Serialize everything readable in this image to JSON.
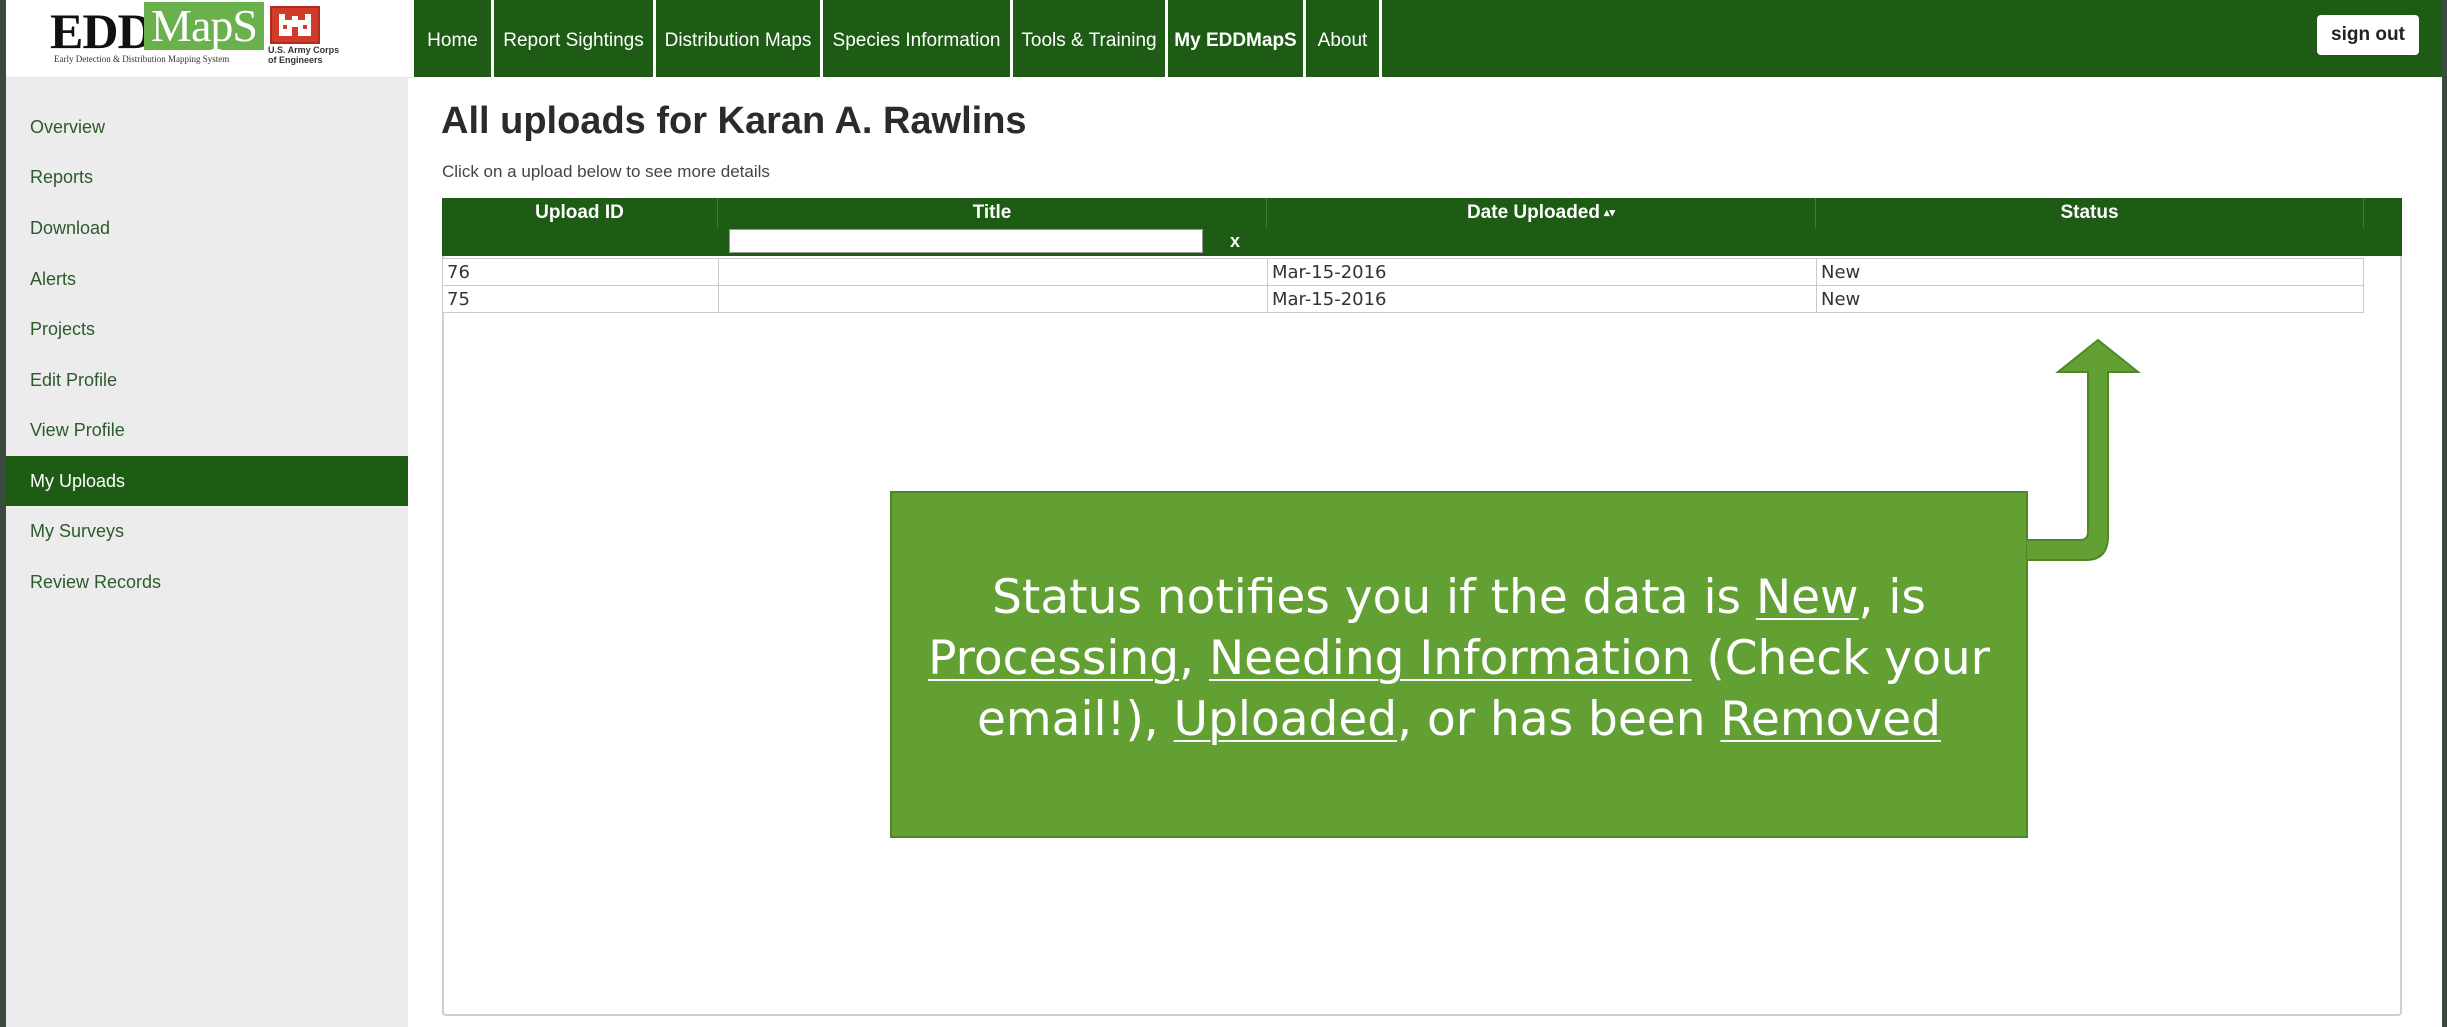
{
  "brand": {
    "logo_edd": "EDD",
    "logo_maps": "MapS",
    "tagline": "Early Detection & Distribution Mapping System",
    "partner_line1": "U.S. Army Corps",
    "partner_line2": "of Engineers"
  },
  "nav": {
    "items": [
      {
        "label": "Home"
      },
      {
        "label": "Report Sightings"
      },
      {
        "label": "Distribution Maps"
      },
      {
        "label": "Species Information"
      },
      {
        "label": "Tools & Training"
      },
      {
        "label": "My EDDMapS"
      },
      {
        "label": "About"
      }
    ],
    "sign_out": "sign out"
  },
  "sidebar": {
    "items": [
      {
        "label": "Overview"
      },
      {
        "label": "Reports"
      },
      {
        "label": "Download"
      },
      {
        "label": "Alerts"
      },
      {
        "label": "Projects"
      },
      {
        "label": "Edit Profile"
      },
      {
        "label": "View Profile"
      },
      {
        "label": "My Uploads",
        "active": true
      },
      {
        "label": "My Surveys"
      },
      {
        "label": "Review Records"
      }
    ]
  },
  "main": {
    "title": "All uploads for Karan A. Rawlins",
    "hint": "Click on a upload below to see more details",
    "table": {
      "columns": [
        "Upload ID",
        "Title",
        "Date Uploaded",
        "Status"
      ],
      "sort_icon": "sort-desc-icon",
      "filter_clear": "x",
      "filter_value": "",
      "rows": [
        {
          "id": "76",
          "title": "",
          "date": "Mar-15-2016",
          "status": "New"
        },
        {
          "id": "75",
          "title": "",
          "date": "Mar-15-2016",
          "status": "New"
        }
      ]
    }
  },
  "callout": {
    "t1": "Status notifies you if the data is ",
    "s_new": "New",
    "t2": ", is ",
    "s_processing": "Processing",
    "t3": ", ",
    "s_needing": "Needing Information",
    "t4": " (Check your email!), ",
    "s_uploaded": "Uploaded",
    "t5": ", or has been ",
    "s_removed": "Removed",
    "arrow_icon": "up-arrow-icon"
  },
  "colors": {
    "nav_green": "#1e5c16",
    "callout_green": "#62a033",
    "sidebar_bg": "#ececec"
  }
}
